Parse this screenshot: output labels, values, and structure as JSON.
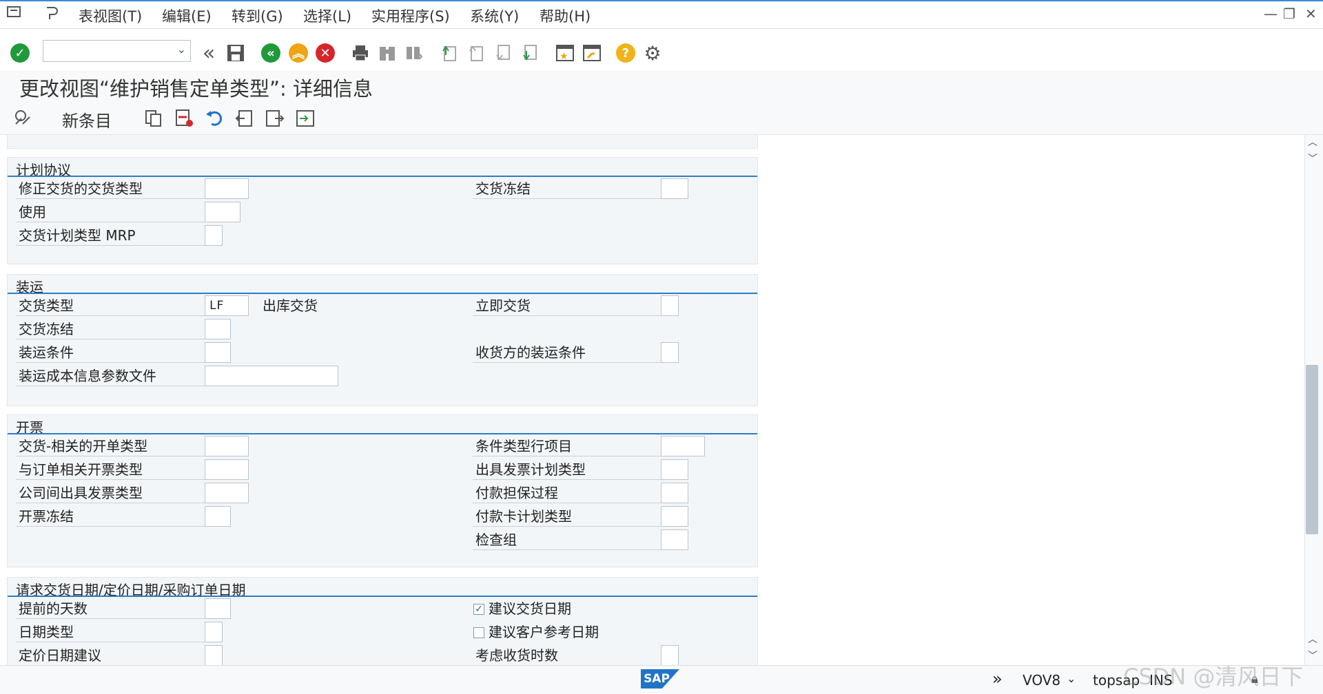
{
  "menubar": {
    "items": [
      "表视图(T)",
      "编辑(E)",
      "转到(G)",
      "选择(L)",
      "实用程序(S)",
      "系统(Y)",
      "帮助(H)"
    ]
  },
  "toolbar": {
    "icons": [
      "enter-icon",
      "back-double-icon",
      "save-icon",
      "back-icon",
      "exit-icon",
      "cancel-icon",
      "print-icon",
      "find-icon",
      "find-next-icon",
      "first-page-icon",
      "previous-page-icon",
      "next-page-icon",
      "last-page-icon",
      "new-session-icon",
      "shortcut-icon",
      "help-icon",
      "settings-icon"
    ]
  },
  "title": "更改视图“维护销售定单类型”: 详细信息",
  "app_toolbar": {
    "new_entries": "新条目"
  },
  "sections": {
    "schedule": {
      "title": "计划协议",
      "fields": {
        "correction_delivery_type": {
          "label": "修正交货的交货类型",
          "value": ""
        },
        "usage": {
          "label": "使用",
          "value": ""
        },
        "delivery_schedule_type_mrp": {
          "label": "交货计划类型 MRP",
          "value": ""
        },
        "delivery_block": {
          "label": "交货冻结",
          "value": ""
        }
      }
    },
    "shipping": {
      "title": "装运",
      "fields": {
        "delivery_type": {
          "label": "交货类型",
          "value": "LF",
          "desc": "出库交货"
        },
        "delivery_block": {
          "label": "交货冻结",
          "value": ""
        },
        "shipping_conditions": {
          "label": "装运条件",
          "value": ""
        },
        "shipping_cost_profile": {
          "label": "装运成本信息参数文件",
          "value": ""
        },
        "immediate_delivery": {
          "label": "立即交货",
          "value": ""
        },
        "ship_to_shipping_conditions": {
          "label": "收货方的装运条件",
          "value": ""
        }
      }
    },
    "billing": {
      "title": "开票",
      "fields": {
        "delivery_related_billing_type": {
          "label": "交货-相关的开单类型",
          "value": ""
        },
        "order_related_billing_type": {
          "label": "与订单相关开票类型",
          "value": ""
        },
        "intercompany_billing_type": {
          "label": "公司间出具发票类型",
          "value": ""
        },
        "billing_block": {
          "label": "开票冻结",
          "value": ""
        },
        "condition_type_line_items": {
          "label": "条件类型行项目",
          "value": ""
        },
        "billing_plan_type": {
          "label": "出具发票计划类型",
          "value": ""
        },
        "payment_guarantee_procedure": {
          "label": "付款担保过程",
          "value": ""
        },
        "payment_card_plan_type": {
          "label": "付款卡计划类型",
          "value": ""
        },
        "checking_group": {
          "label": "检查组",
          "value": ""
        }
      }
    },
    "dates": {
      "title": "请求交货日期/定价日期/采购订单日期",
      "fields": {
        "lead_time_days": {
          "label": "提前的天数",
          "value": ""
        },
        "date_type": {
          "label": "日期类型",
          "value": ""
        },
        "pricing_date_proposal": {
          "label": "定价日期建议",
          "value": ""
        },
        "propose_delivery_date": {
          "label": "建议交货日期",
          "checked": true
        },
        "propose_cust_ref_date": {
          "label": "建议客户参考日期",
          "checked": false
        },
        "consider_receiving_times": {
          "label": "考虑收货时数",
          "value": ""
        }
      }
    }
  },
  "statusbar": {
    "transaction": "VOV8",
    "server": "topsap",
    "mode": "INS",
    "logo": "SAP",
    "watermark": "CSDN @清风日下"
  },
  "colors": {
    "accent": "#2d7bc7",
    "confirm_green": "#1f9a3a",
    "back_orange": "#f0a414",
    "cancel_red": "#d6262b",
    "help_yellow": "#f0b419"
  }
}
